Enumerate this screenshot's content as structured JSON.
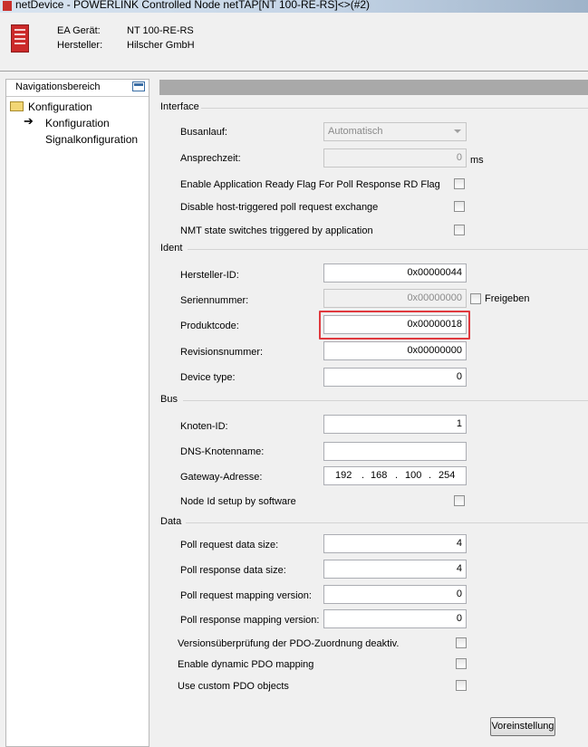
{
  "window": {
    "title": "netDevice - POWERLINK Controlled Node netTAP[NT 100-RE-RS]<>(#2)"
  },
  "header": {
    "device_label": "EA Gerät:",
    "device_value": "NT 100-RE-RS",
    "vendor_label": "Hersteller:",
    "vendor_value": "Hilscher GmbH"
  },
  "nav": {
    "title": "Navigationsbereich",
    "items": [
      "Konfiguration",
      "Konfiguration",
      "Signalkonfiguration"
    ]
  },
  "interface": {
    "group": "Interface",
    "busstart_label": "Busanlauf:",
    "busstart_value": "Automatisch",
    "timeout_label": "Ansprechzeit:",
    "timeout_value": "0",
    "timeout_unit": "ms",
    "enable_rd_flag": "Enable Application Ready Flag For Poll Response RD Flag",
    "disable_host": "Disable host-triggered poll request exchange",
    "nmt_state": "NMT state switches triggered by application"
  },
  "ident": {
    "group": "Ident",
    "vendor_id_label": "Hersteller-ID:",
    "vendor_id_value": "0x00000044",
    "serial_label": "Seriennummer:",
    "serial_value": "0x00000000",
    "serial_release": "Freigeben",
    "product_label": "Produktcode:",
    "product_value": "0x00000018",
    "revision_label": "Revisionsnummer:",
    "revision_value": "0x00000000",
    "device_type_label": "Device type:",
    "device_type_value": "0"
  },
  "bus": {
    "group": "Bus",
    "node_id_label": "Knoten-ID:",
    "node_id_value": "1",
    "dns_label": "DNS-Knotenname:",
    "dns_value": "",
    "gateway_label": "Gateway-Adresse:",
    "gateway_parts": [
      "192",
      "168",
      "100",
      "254"
    ],
    "node_sw_label": "Node Id setup by software"
  },
  "data": {
    "group": "Data",
    "poll_req_size_label": "Poll request data size:",
    "poll_req_size_value": "4",
    "poll_resp_size_label": "Poll response data size:",
    "poll_resp_size_value": "4",
    "poll_req_map_label": "Poll request mapping version:",
    "poll_req_map_value": "0",
    "poll_resp_map_label": "Poll response mapping version:",
    "poll_resp_map_value": "0",
    "pdo_check_label": "Versionsüberprüfung der PDO-Zuordnung deaktiv.",
    "dynamic_pdo_label": "Enable dynamic PDO mapping",
    "custom_pdo_label": "Use custom PDO objects"
  },
  "footer": {
    "reset_button": "Voreinstellung"
  },
  "colors": {
    "highlight": "#e0393e",
    "device_icon": "#cc2a2a"
  }
}
